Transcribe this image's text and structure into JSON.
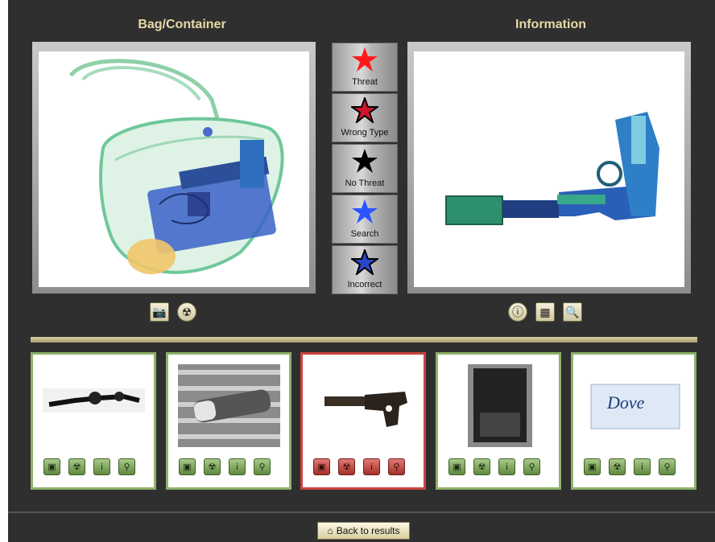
{
  "titles": {
    "bag": "Bag/Container",
    "info": "Information"
  },
  "ratings": [
    {
      "label": "Threat",
      "icon": "red-star-icon",
      "color": "#ff1a1a"
    },
    {
      "label": "Wrong Type",
      "icon": "red-outlined-star-icon",
      "color": "#d0142b"
    },
    {
      "label": "No Threat",
      "icon": "black-star-icon",
      "color": "#000000"
    },
    {
      "label": "Search",
      "icon": "blue-star-icon",
      "color": "#2a55ff"
    },
    {
      "label": "Incorrect",
      "icon": "blue-outlined-star-icon",
      "color": "#2b45c9"
    }
  ],
  "bag_tools": [
    "camera-icon",
    "radiation-icon"
  ],
  "info_tools": [
    "info-icon",
    "grid-icon",
    "document-magnifier-icon"
  ],
  "thumbnails": [
    {
      "name": "thumb-knife-keychain",
      "selected": false
    },
    {
      "name": "thumb-flashlight",
      "selected": false
    },
    {
      "name": "thumb-pistol",
      "selected": true
    },
    {
      "name": "thumb-dark-case",
      "selected": false
    },
    {
      "name": "thumb-dove-soap",
      "selected": false,
      "text": "Dove"
    }
  ],
  "thumb_icons": [
    "camera-icon",
    "radiation-icon",
    "info-icon",
    "search-icon"
  ],
  "footer": {
    "back_label": "Back to results"
  },
  "colors": {
    "background": "#2f2f2f",
    "title": "#e7d9a6",
    "thumb_border": "#8fb26b",
    "thumb_selected_border": "#c9443f"
  }
}
